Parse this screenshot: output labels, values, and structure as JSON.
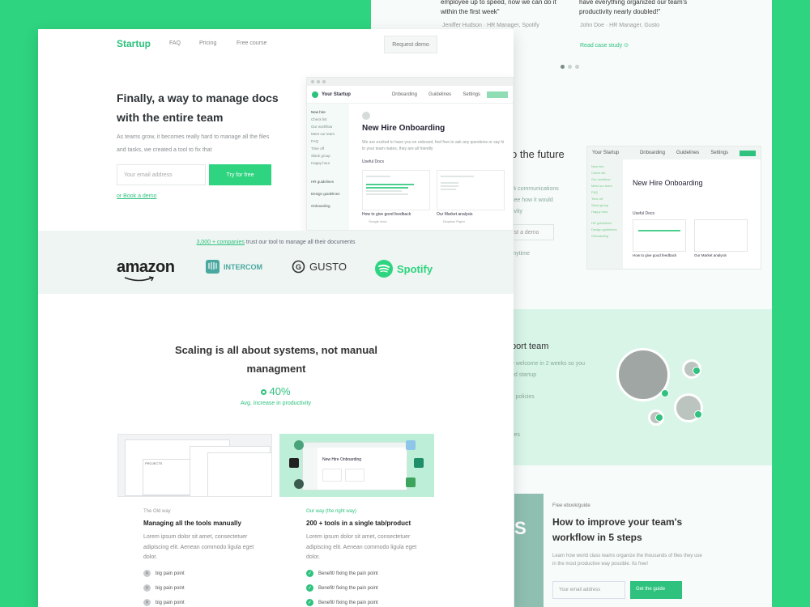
{
  "back": {
    "quote_left": "employee up to speed, now we can do it within the first week\"",
    "quote_left_meta": "Jeniffer Hudson · HR Manager, Spotify",
    "quote_right": "have everything organized our team's productivity nearly doubled!\"",
    "quote_right_meta": "John Doe · HR Manager, Gusto",
    "read_case": "Read case study  ⊙",
    "future_heading": "o the future",
    "future_lines": [
      "% communications",
      "see how it would",
      "tivity"
    ],
    "request_demo": "quest a demo",
    "anytime": "el anytime",
    "app_brand": "Your Startup",
    "app_tabs": [
      "Onboarding",
      "Guidelines",
      "Settings"
    ],
    "app_title": "New Hire Onboarding",
    "app_sidebar": [
      "New hire",
      "Check list",
      "Our workflow",
      "Meet our team",
      "FAQ",
      "Time off",
      "Slack group",
      "Happy hour",
      "HR guidelines",
      "Design guidelines",
      "Onboarding"
    ],
    "app_useful": "Useful Docs",
    "app_cap1": "How to give good feedback",
    "app_cap2": "Our Market analysis",
    "support_heading": "port team",
    "support_lines": [
      "e welcome in 2 weeks so you",
      "ed startup"
    ],
    "support_line3": "s policies",
    "support_line4": "ties",
    "teal_letter": "S",
    "ebook_tag": "Free ebook/guide",
    "ebook_title": "How to improve your team's workflow in 5 steps",
    "ebook_desc": "Learn how world class teams organize the thousands of files they use in the most productive way possible. Its free!",
    "ebook_placeholder": "Your email address",
    "ebook_btn": "Get the guide"
  },
  "nav": {
    "logo": "Startup",
    "links": [
      "FAQ",
      "Pricing",
      "Free course"
    ],
    "demo": "Request demo"
  },
  "hero": {
    "title": "Finally, a way to manage docs with the entire team",
    "subtitle": "As teams grow, it becomes really hard to manage all the files and tasks, we created a tool to fix that",
    "email_placeholder": "Your email address",
    "cta": "Try for free",
    "book": "or Book a demo"
  },
  "app": {
    "brand": "Your Startup",
    "tabs": [
      "Onboarding",
      "Guidelines",
      "Settings"
    ],
    "sidebar_top": [
      "New hire",
      "Check list",
      "Our workflow",
      "Meet our team",
      "FAQ",
      "Time off",
      "Slack group",
      "Happy hour"
    ],
    "sidebar_groups": [
      "HR guidelines",
      "Design guidelines",
      "Onboarding"
    ],
    "title": "New Hire Onboarding",
    "desc": "We are excited to have you on onboard, feel free to ask any questions or say hi to your team mates, they are all friendly",
    "useful": "Useful Docs",
    "cards": [
      {
        "title": "How to give good feedback",
        "sub": "Google docs"
      },
      {
        "title": "Our Market analysis",
        "sub": "Dropbox Paper"
      }
    ]
  },
  "brands": {
    "count_link": "3,000 + companies",
    "caption_rest": " trust our tool to manage all their documents",
    "names": [
      "amazon",
      "INTERCOM",
      "GUSTO",
      "Spotify"
    ]
  },
  "scale": {
    "title": "Scaling is all about systems, not manual managment",
    "stat": "40%",
    "stat_caption": "Avg. increase in productivity"
  },
  "columns": {
    "old": {
      "tag": "The Old way",
      "title": "Managing all the tools manually",
      "text": "Lorem ipsum dolor sit amet, consectetuer adipiscing elit. Aenean commodo ligula eget dolor.",
      "points": [
        "big pain point",
        "big pain point",
        "big pain point"
      ]
    },
    "new": {
      "tag": "Our way (the right way)",
      "title": "200 + tools in a single tab/product",
      "text": "Lorem ipsum dolor sit amet, consectetuer adipiscing elit. Aenean commodo ligula eget dolor.",
      "points": [
        "Benefit/ fixing the pain point",
        "Benefit/ fixing the pain point",
        "Benefit/ fixing the pain point"
      ]
    },
    "old_window_label": "PROJECTS",
    "new_window_label": "New Hire Onboarding"
  },
  "colors": {
    "accent": "#2ed47f",
    "background": "#2ed47f",
    "tint": "#eef5f2"
  }
}
